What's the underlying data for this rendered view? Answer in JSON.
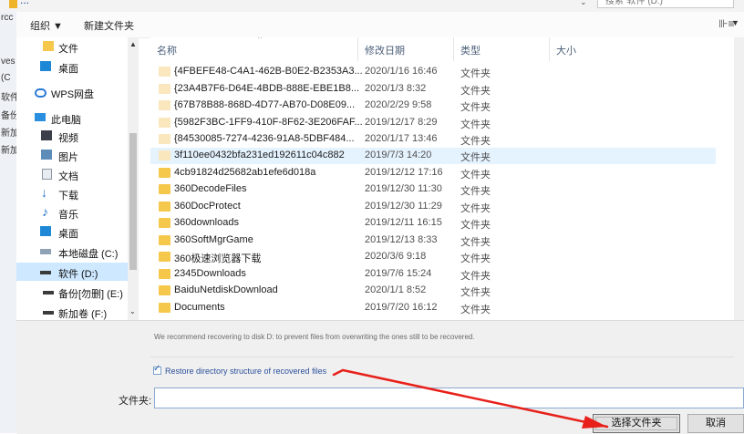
{
  "address_bar": {
    "path_fragment": "...",
    "search_placeholder": "搜索\"软件 (D:)\""
  },
  "toolbar": {
    "organize_label": "组织 ▼",
    "new_folder_label": "新建文件夹",
    "view_icon": "view-options-icon"
  },
  "background_window": {
    "text_fragments": [
      "rcc",
      "ves",
      "(C",
      "软件",
      "备份",
      "新加",
      "新加"
    ]
  },
  "nav": {
    "items": [
      {
        "label": "文件",
        "icon": "folder-icon",
        "selected": false
      },
      {
        "label": "桌面",
        "icon": "desktop-icon",
        "selected": false
      },
      {
        "label": "WPS网盘",
        "icon": "cloud-icon",
        "selected": false
      },
      {
        "label": "此电脑",
        "icon": "computer-icon",
        "selected": false
      },
      {
        "label": "视频",
        "icon": "video-icon",
        "selected": false
      },
      {
        "label": "图片",
        "icon": "picture-icon",
        "selected": false
      },
      {
        "label": "文档",
        "icon": "document-icon",
        "selected": false
      },
      {
        "label": "下载",
        "icon": "download-icon",
        "selected": false
      },
      {
        "label": "音乐",
        "icon": "music-icon",
        "selected": false
      },
      {
        "label": "桌面",
        "icon": "desktop-icon",
        "selected": false
      },
      {
        "label": "本地磁盘 (C:)",
        "icon": "drive-icon",
        "selected": false
      },
      {
        "label": "软件 (D:)",
        "icon": "drive-icon",
        "selected": true
      },
      {
        "label": "备份[勿删] (E:)",
        "icon": "drive-icon",
        "selected": false
      },
      {
        "label": "新加卷 (F:)",
        "icon": "drive-icon",
        "selected": false
      }
    ]
  },
  "columns": {
    "name": "名称",
    "modified": "修改日期",
    "type": "类型",
    "size": "大小"
  },
  "files": [
    {
      "name": "{4FBEFE48-C4A1-462B-B0E2-B2353A3...",
      "modified": "2020/1/16 16:46",
      "type": "文件夹",
      "hidden": true,
      "selected": false
    },
    {
      "name": "{23A4B7F6-D64E-4BDB-888E-EBE1B8...",
      "modified": "2020/1/3 8:32",
      "type": "文件夹",
      "hidden": true,
      "selected": false
    },
    {
      "name": "{67B78B88-868D-4D77-AB70-D08E09...",
      "modified": "2020/2/29 9:58",
      "type": "文件夹",
      "hidden": true,
      "selected": false
    },
    {
      "name": "{5982F3BC-1FF9-410F-8F62-3E206FAF...",
      "modified": "2019/12/17 8:29",
      "type": "文件夹",
      "hidden": true,
      "selected": false
    },
    {
      "name": "{84530085-7274-4236-91A8-5DBF484...",
      "modified": "2020/1/17 13:46",
      "type": "文件夹",
      "hidden": true,
      "selected": false
    },
    {
      "name": "3f110ee0432bfa231ed192611c04c882",
      "modified": "2019/7/3 14:20",
      "type": "文件夹",
      "hidden": true,
      "selected": true
    },
    {
      "name": "4cb91824d25682ab1efe6d018a",
      "modified": "2019/12/12 17:16",
      "type": "文件夹",
      "hidden": false,
      "selected": false
    },
    {
      "name": "360DecodeFiles",
      "modified": "2019/12/30 11:30",
      "type": "文件夹",
      "hidden": false,
      "selected": false
    },
    {
      "name": "360DocProtect",
      "modified": "2019/12/30 11:29",
      "type": "文件夹",
      "hidden": false,
      "selected": false
    },
    {
      "name": "360downloads",
      "modified": "2019/12/11 16:15",
      "type": "文件夹",
      "hidden": false,
      "selected": false
    },
    {
      "name": "360SoftMgrGame",
      "modified": "2019/12/13 8:33",
      "type": "文件夹",
      "hidden": false,
      "selected": false
    },
    {
      "name": "360极速浏览器下载",
      "modified": "2020/3/6 9:18",
      "type": "文件夹",
      "hidden": false,
      "selected": false
    },
    {
      "name": "2345Downloads",
      "modified": "2019/7/6 15:24",
      "type": "文件夹",
      "hidden": false,
      "selected": false
    },
    {
      "name": "BaiduNetdiskDownload",
      "modified": "2020/1/1 8:52",
      "type": "文件夹",
      "hidden": false,
      "selected": false
    },
    {
      "name": "Documents",
      "modified": "2019/7/20 16:12",
      "type": "文件夹",
      "hidden": false,
      "selected": false
    }
  ],
  "recommend_text": "We recommend recovering to disk D: to prevent files from overwriting the ones still to be recovered.",
  "restore_checkbox": {
    "label": "Restore directory structure of recovered files",
    "checked": true
  },
  "folder_field": {
    "label": "文件夹:",
    "value": ""
  },
  "buttons": {
    "select_folder": "选择文件夹",
    "cancel": "取消"
  },
  "colors": {
    "annotation_red": "#e8201a",
    "selection_blue": "#cde8ff",
    "folder_yellow": "#f5c84c"
  }
}
